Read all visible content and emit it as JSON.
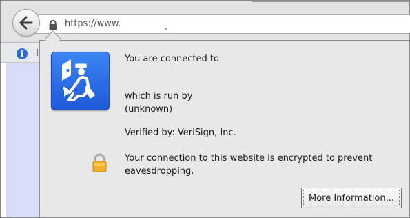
{
  "navigation": {
    "url_text": "https://www."
  },
  "info_bar": {
    "icon_name": "info-icon",
    "visible_text": "I"
  },
  "identity_popup": {
    "icon_name": "identity-passport-icon",
    "connected_to": "You are connected to",
    "run_by": "which is run by",
    "owner": "(unknown)",
    "verified_by": "Verified by: VeriSign, Inc.",
    "security_message_line1": "Your connection to this website is encrypted to prevent",
    "security_message_line2": "eavesdropping.",
    "more_info_button": "More Information..."
  },
  "icons": {
    "back": "back-arrow-icon",
    "url_lock": "lock-icon",
    "encryption_lock": "padlock-icon"
  },
  "colors": {
    "toolbar": "#e3e3e3",
    "popup_background": "#e8e8e8",
    "identity_icon": "#2f6df0",
    "info_icon": "#2d6bd6",
    "left_strip": "#d7ddf7"
  }
}
